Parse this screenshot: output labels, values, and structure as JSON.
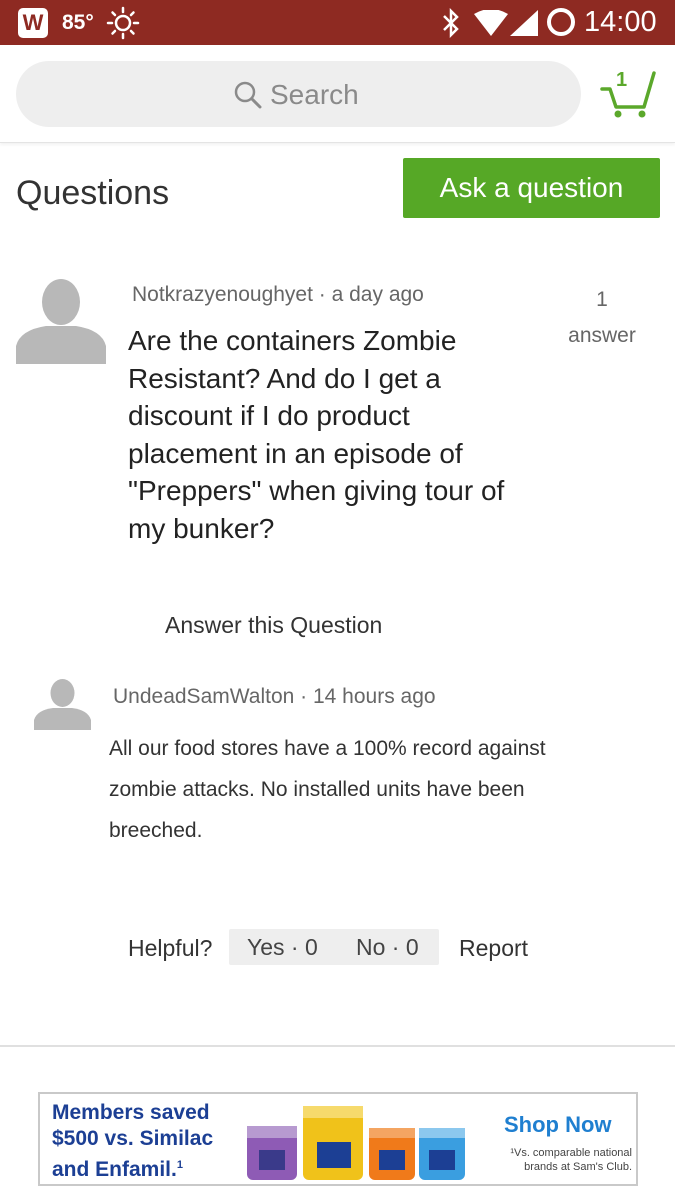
{
  "status_bar": {
    "app_badge": "W",
    "temperature": "85°",
    "time": "14:00"
  },
  "header": {
    "search_placeholder": "Search",
    "cart_count": "1"
  },
  "questions": {
    "title": "Questions",
    "ask_button": "Ask a question"
  },
  "question": {
    "author": "Notkrazyenoughyet",
    "age": " · a day ago",
    "text": "Are the containers Zombie Resistant?  And do I get a discount if I do product placement in an episode of \"Preppers\" when giving tour of my bunker?",
    "answer_count": "1",
    "answer_label": "answer",
    "answer_link": "Answer this Question"
  },
  "answer": {
    "author": "UndeadSamWalton",
    "age": " · 14 hours ago",
    "text": "All our food stores have a 100% record against zombie attacks. No installed units have been breeched."
  },
  "feedback": {
    "helpful_label": "Helpful?",
    "yes": "Yes · 0",
    "no": "No · 0",
    "report": "Report"
  },
  "ad": {
    "headline_1": "Members saved",
    "headline_2": "$500 vs. Similac",
    "headline_3": "and Enfamil.",
    "headline_footnote": "1",
    "cta": "Shop Now",
    "fine_print": "¹Vs. comparable national brands at Sam's Club."
  },
  "colors": {
    "status_bar": "#8e2a22",
    "accent_green": "#56a826",
    "ad_blue": "#1c3f94"
  }
}
